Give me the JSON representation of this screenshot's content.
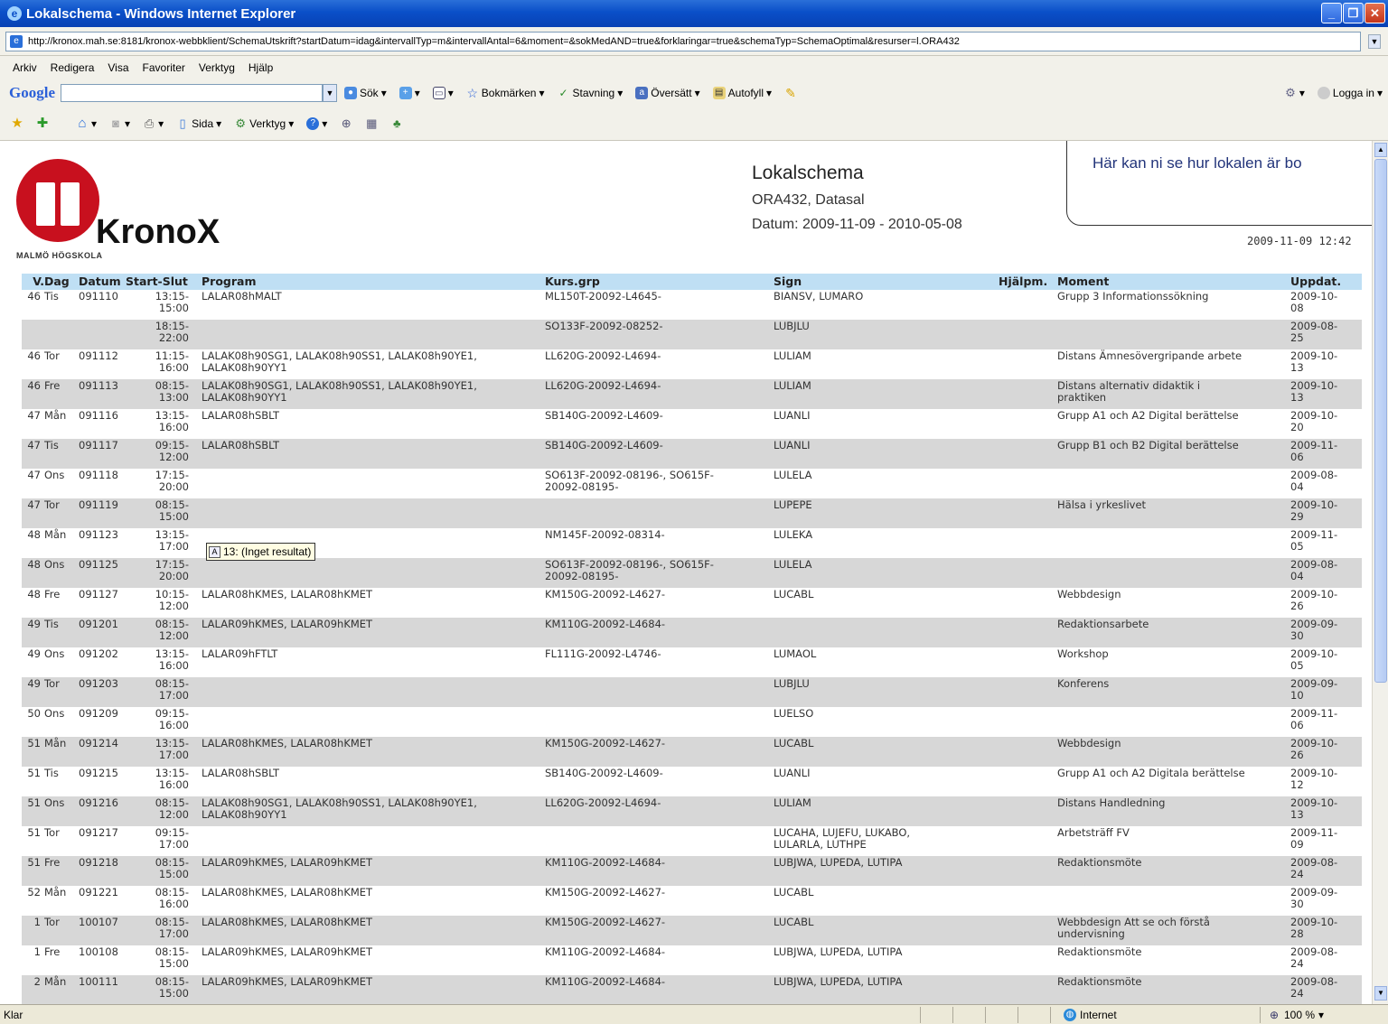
{
  "window": {
    "title": "Lokalschema - Windows Internet Explorer"
  },
  "address": {
    "url": "http://kronox.mah.se:8181/kronox-webbklient/SchemaUtskrift?startDatum=idag&intervallTyp=m&intervallAntal=6&moment=&sokMedAND=true&forklaringar=true&schemaTyp=SchemaOptimal&resurser=l.ORA432"
  },
  "menu": [
    "Arkiv",
    "Redigera",
    "Visa",
    "Favoriter",
    "Verktyg",
    "Hjälp"
  ],
  "google_bar": {
    "logo": "Google",
    "search_label": "Sök",
    "bookmarks": "Bokmärken",
    "spelling": "Stavning",
    "translate": "Översätt",
    "autofill": "Autofyll",
    "login": "Logga in"
  },
  "command_bar": {
    "page": "Sida",
    "tools": "Verktyg"
  },
  "logo": {
    "name": "KronoX",
    "school": "MALMÖ HÖGSKOLA"
  },
  "header": {
    "title": "Lokalschema",
    "room": "ORA432, Datasal",
    "dates": "Datum: 2009-11-09 - 2010-05-08",
    "stamp": "2009-11-09 12:42"
  },
  "callout": {
    "text": "Här kan ni se hur lokalen är bo"
  },
  "tooltip": {
    "text": "13: (Inget resultat)"
  },
  "table": {
    "headers": [
      "V.",
      "Dag",
      "Datum",
      "Start-Slut",
      "Program",
      "Kurs.grp",
      "Sign",
      "Hjälpm.",
      "Moment",
      "Uppdat."
    ],
    "rows": [
      [
        "46",
        "Tis",
        "091110",
        "13:15-\n15:00",
        "LALAR08hMALT",
        "ML150T-20092-L4645-",
        "BIANSV, LUMARO",
        "",
        "Grupp 3 Informationssökning",
        "2009-10-\n08"
      ],
      [
        "",
        "",
        "",
        "18:15-\n22:00",
        "",
        "SO133F-20092-08252-",
        "LUBJLU",
        "",
        "",
        "2009-08-\n25"
      ],
      [
        "46",
        "Tor",
        "091112",
        "11:15-\n16:00",
        "LALAK08h90SG1, LALAK08h90SS1, LALAK08h90YE1,\nLALAK08h90YY1",
        "LL620G-20092-L4694-",
        "LULIAM",
        "",
        "Distans Ämnesövergripande arbete",
        "2009-10-\n13"
      ],
      [
        "46",
        "Fre",
        "091113",
        "08:15-\n13:00",
        "LALAK08h90SG1, LALAK08h90SS1, LALAK08h90YE1,\nLALAK08h90YY1",
        "LL620G-20092-L4694-",
        "LULIAM",
        "",
        "Distans alternativ didaktik i\npraktiken",
        "2009-10-\n13"
      ],
      [
        "47",
        "Mån",
        "091116",
        "13:15-\n16:00",
        "LALAR08hSBLT",
        "SB140G-20092-L4609-",
        "LUANLI",
        "",
        "Grupp A1 och A2 Digital berättelse",
        "2009-10-\n20"
      ],
      [
        "47",
        "Tis",
        "091117",
        "09:15-\n12:00",
        "LALAR08hSBLT",
        "SB140G-20092-L4609-",
        "LUANLI",
        "",
        "Grupp B1 och B2 Digital berättelse",
        "2009-11-\n06"
      ],
      [
        "47",
        "Ons",
        "091118",
        "17:15-\n20:00",
        "",
        "SO613F-20092-08196-, SO615F-\n20092-08195-",
        "LULELA",
        "",
        "",
        "2009-08-\n04"
      ],
      [
        "47",
        "Tor",
        "091119",
        "08:15-\n15:00",
        "",
        "",
        "LUPEPE",
        "",
        "Hälsa i yrkeslivet",
        "2009-10-\n29"
      ],
      [
        "48",
        "Mån",
        "091123",
        "13:15-\n17:00",
        "",
        "NM145F-20092-08314-",
        "LULEKA",
        "",
        "",
        "2009-11-\n05"
      ],
      [
        "48",
        "Ons",
        "091125",
        "17:15-\n20:00",
        "",
        "SO613F-20092-08196-, SO615F-\n20092-08195-",
        "LULELA",
        "",
        "",
        "2009-08-\n04"
      ],
      [
        "48",
        "Fre",
        "091127",
        "10:15-\n12:00",
        "LALAR08hKMES, LALAR08hKMET",
        "KM150G-20092-L4627-",
        "LUCABL",
        "",
        "Webbdesign",
        "2009-10-\n26"
      ],
      [
        "49",
        "Tis",
        "091201",
        "08:15-\n12:00",
        "LALAR09hKMES, LALAR09hKMET",
        "KM110G-20092-L4684-",
        "",
        "",
        "Redaktionsarbete",
        "2009-09-\n30"
      ],
      [
        "49",
        "Ons",
        "091202",
        "13:15-\n16:00",
        "LALAR09hFTLT",
        "FL111G-20092-L4746-",
        "LUMAOL",
        "",
        "Workshop",
        "2009-10-\n05"
      ],
      [
        "49",
        "Tor",
        "091203",
        "08:15-\n17:00",
        "",
        "",
        "LUBJLU",
        "",
        "Konferens",
        "2009-09-\n10"
      ],
      [
        "50",
        "Ons",
        "091209",
        "09:15-\n16:00",
        "",
        "",
        "LUELSO",
        "",
        "",
        "2009-11-\n06"
      ],
      [
        "51",
        "Mån",
        "091214",
        "13:15-\n17:00",
        "LALAR08hKMES, LALAR08hKMET",
        "KM150G-20092-L4627-",
        "LUCABL",
        "",
        "Webbdesign",
        "2009-10-\n26"
      ],
      [
        "51",
        "Tis",
        "091215",
        "13:15-\n16:00",
        "LALAR08hSBLT",
        "SB140G-20092-L4609-",
        "LUANLI",
        "",
        "Grupp A1 och A2 Digitala berättelse",
        "2009-10-\n12"
      ],
      [
        "51",
        "Ons",
        "091216",
        "08:15-\n12:00",
        "LALAK08h90SG1, LALAK08h90SS1, LALAK08h90YE1,\nLALAK08h90YY1",
        "LL620G-20092-L4694-",
        "LULIAM",
        "",
        "Distans Handledning",
        "2009-10-\n13"
      ],
      [
        "51",
        "Tor",
        "091217",
        "09:15-\n17:00",
        "",
        "",
        "LUCAHA, LUJEFU, LUKABO,\nLULARLA, LUTHPE",
        "",
        "Arbetsträff FV",
        "2009-11-\n09"
      ],
      [
        "51",
        "Fre",
        "091218",
        "08:15-\n15:00",
        "LALAR09hKMES, LALAR09hKMET",
        "KM110G-20092-L4684-",
        "LUBJWA, LUPEDA, LUTIPA",
        "",
        "Redaktionsmöte",
        "2009-08-\n24"
      ],
      [
        "52",
        "Mån",
        "091221",
        "08:15-\n16:00",
        "LALAR08hKMES, LALAR08hKMET",
        "KM150G-20092-L4627-",
        "LUCABL",
        "",
        "",
        "2009-09-\n30"
      ],
      [
        "1",
        "Tor",
        "100107",
        "08:15-\n17:00",
        "LALAR08hKMES, LALAR08hKMET",
        "KM150G-20092-L4627-",
        "LUCABL",
        "",
        "Webbdesign Att se och förstå\nundervisning",
        "2009-10-\n28"
      ],
      [
        "1",
        "Fre",
        "100108",
        "08:15-\n15:00",
        "LALAR09hKMES, LALAR09hKMET",
        "KM110G-20092-L4684-",
        "LUBJWA, LUPEDA, LUTIPA",
        "",
        "Redaktionsmöte",
        "2009-08-\n24"
      ],
      [
        "2",
        "Mån",
        "100111",
        "08:15-\n15:00",
        "LALAR09hKMES, LALAR09hKMET",
        "KM110G-20092-L4684-",
        "LUBJWA, LUPEDA, LUTIPA",
        "",
        "Redaktionsmöte",
        "2009-08-\n24"
      ]
    ]
  },
  "status": {
    "left": "Klar",
    "zone": "Internet",
    "zoom": "100 %"
  }
}
